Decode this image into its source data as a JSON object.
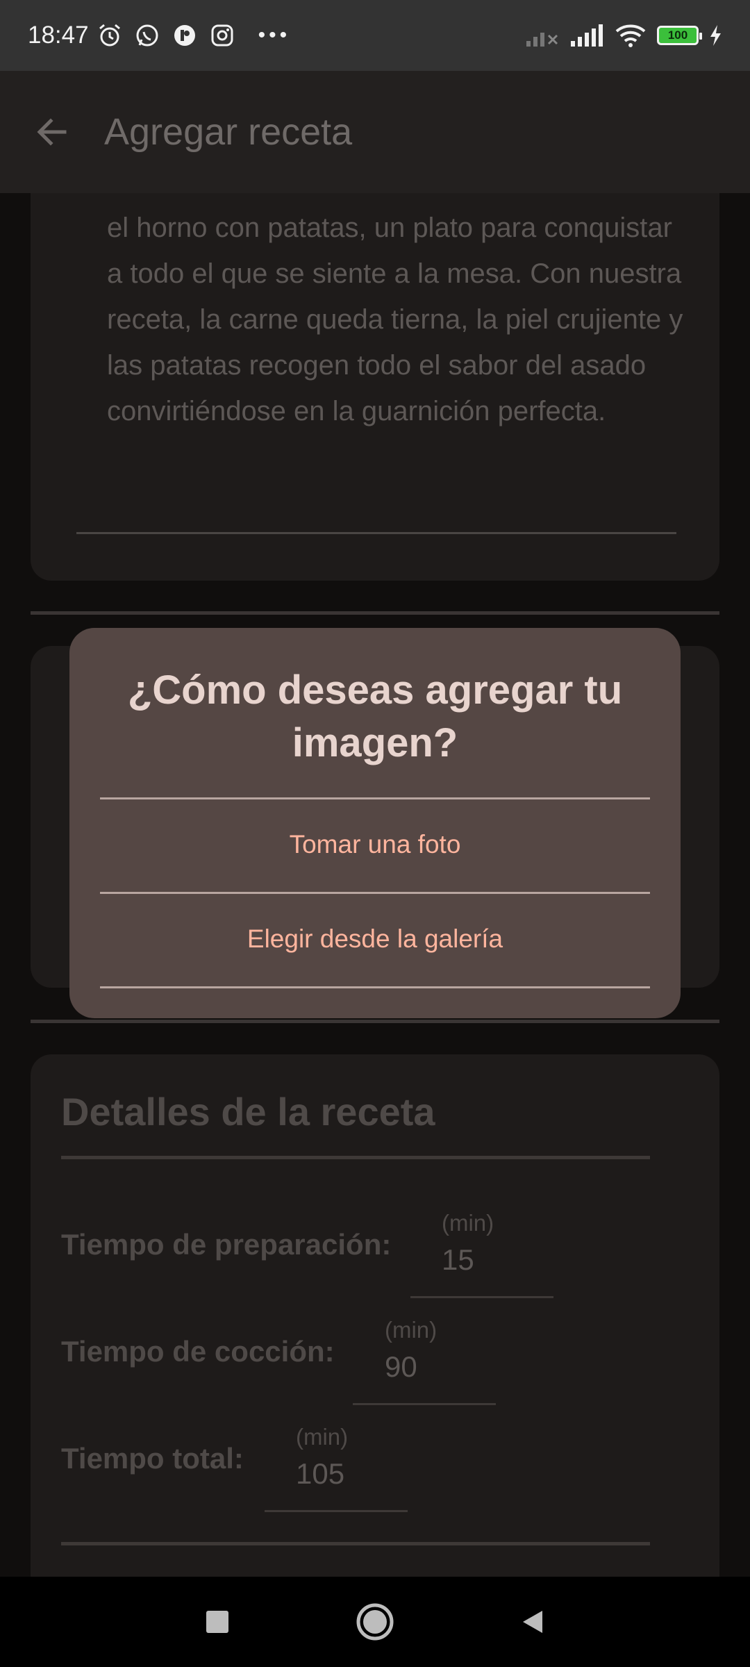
{
  "status_bar": {
    "time": "18:47",
    "battery": "100",
    "icons": [
      "alarm-icon",
      "whatsapp-icon",
      "app-icon",
      "instagram-icon",
      "more-dots-icon",
      "signal-off-icon",
      "signal-icon",
      "wifi-icon",
      "battery-icon",
      "charging-icon"
    ]
  },
  "app_bar": {
    "title": "Agregar receta",
    "back_icon": "arrow-left-icon"
  },
  "description": {
    "text": "el horno con patatas, un plato para conquistar a todo el que se siente a la mesa. Con nuestra receta, la carne queda tierna, la piel crujiente y las patatas recogen todo el sabor del asado convirtiéndose en la guarnición perfecta."
  },
  "dialog": {
    "title": "¿Cómo deseas agregar tu imagen?",
    "option_camera": "Tomar una foto",
    "option_gallery": "Elegir desde la galería"
  },
  "details": {
    "title": "Detalles de la receta",
    "fields": [
      {
        "label": "Tiempo de preparación:",
        "unit": "(min)",
        "value": "15"
      },
      {
        "label": "Tiempo de cocción:",
        "unit": "(min)",
        "value": "90"
      },
      {
        "label": "Tiempo total:",
        "unit": "(min)",
        "value": "105"
      }
    ]
  },
  "colors": {
    "accent": "#ffb59e",
    "dialog_bg": "#554744",
    "surface": "#1e1b1a"
  }
}
